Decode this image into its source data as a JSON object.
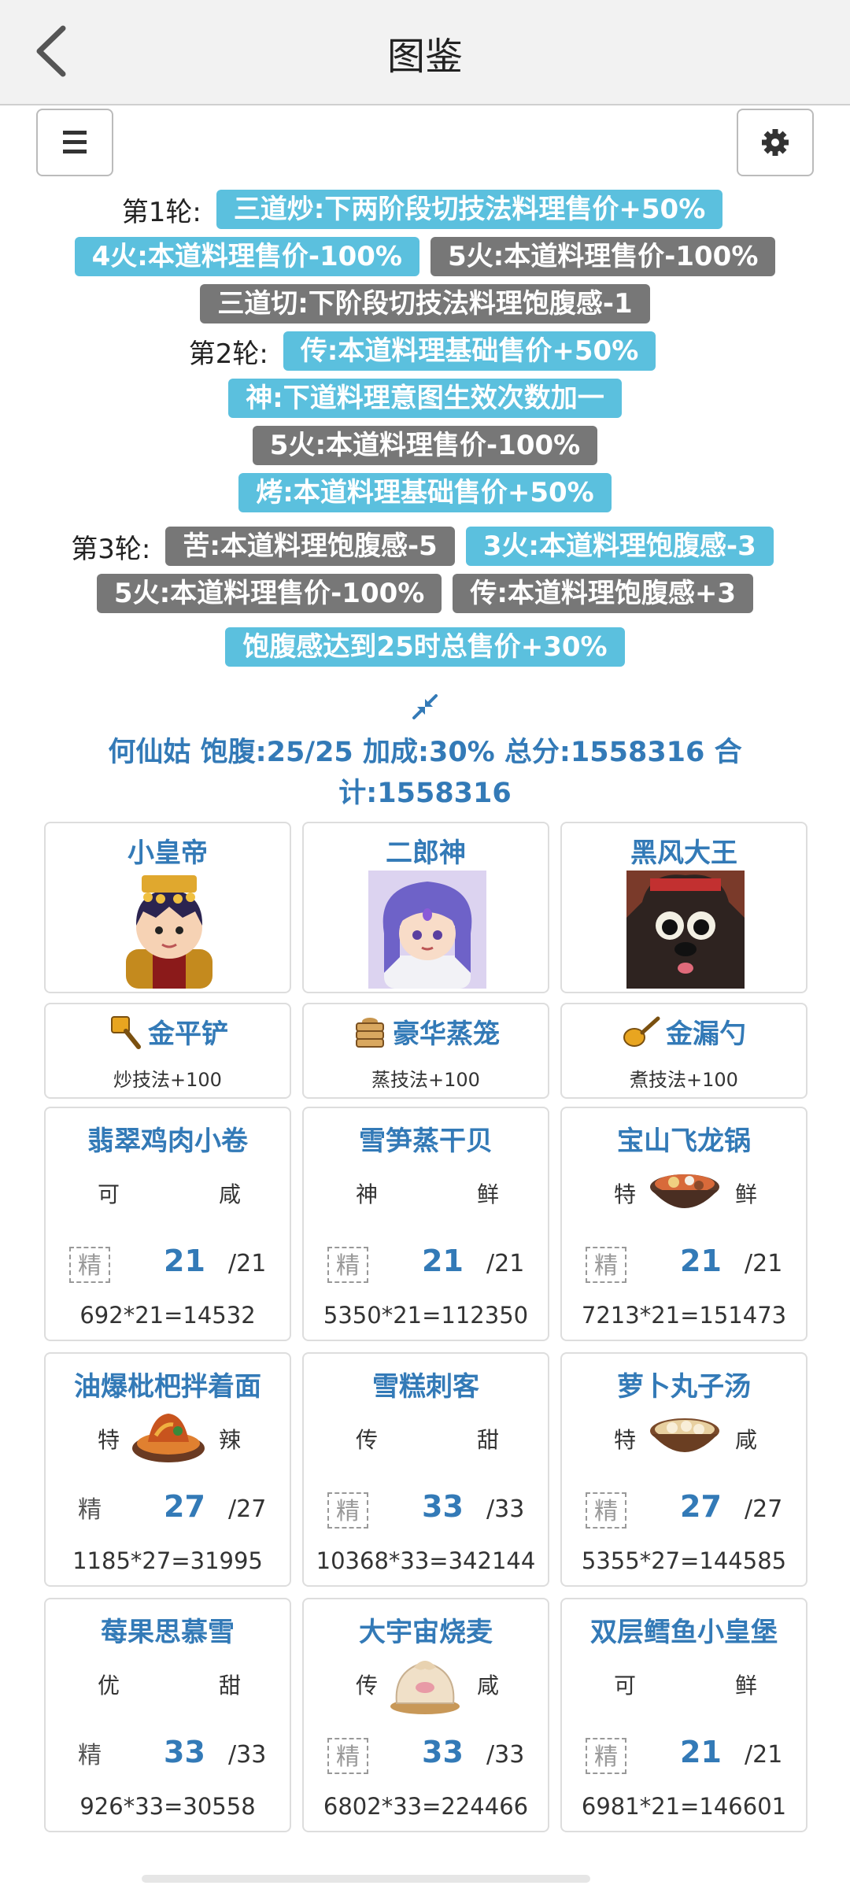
{
  "header": {
    "title": "图鉴"
  },
  "rounds": [
    {
      "label": "第1轮:",
      "rows": [
        [
          {
            "text": "三道炒:下两阶段切技法料理售价+50%",
            "color": "blue"
          }
        ],
        [
          {
            "text": "4火:本道料理售价-100%",
            "color": "blue"
          },
          {
            "text": "5火:本道料理售价-100%",
            "color": "gray"
          }
        ],
        [
          {
            "text": "三道切:下阶段切技法料理饱腹感-1",
            "color": "gray"
          }
        ]
      ]
    },
    {
      "label": "第2轮:",
      "rows": [
        [
          {
            "text": "传:本道料理基础售价+50%",
            "color": "blue"
          }
        ],
        [
          {
            "text": "神:下道料理意图生效次数加一",
            "color": "blue"
          }
        ],
        [
          {
            "text": "5火:本道料理售价-100%",
            "color": "gray"
          }
        ],
        [
          {
            "text": "烤:本道料理基础售价+50%",
            "color": "blue"
          }
        ]
      ]
    },
    {
      "label": "第3轮:",
      "rows": [
        [
          {
            "text": "苦:本道料理饱腹感-5",
            "color": "gray"
          },
          {
            "text": "3火:本道料理饱腹感-3",
            "color": "blue"
          }
        ],
        [
          {
            "text": "5火:本道料理售价-100%",
            "color": "gray"
          },
          {
            "text": "传:本道料理饱腹感+3",
            "color": "gray"
          }
        ],
        [
          {
            "text": "饱腹感达到25时总售价+30%",
            "color": "blue"
          }
        ]
      ]
    }
  ],
  "summary": "何仙姑 饱腹:25/25 加成:30% 总分:1558316 合计:1558316",
  "chefs": [
    {
      "name": "小皇帝",
      "avatar": "emperor-avatar"
    },
    {
      "name": "二郎神",
      "avatar": "erlang-avatar"
    },
    {
      "name": "黑风大王",
      "avatar": "black-wind-avatar"
    }
  ],
  "equips": [
    {
      "name": "金平铲",
      "skill": "炒技法+100",
      "icon": "spatula-icon"
    },
    {
      "name": "豪华蒸笼",
      "skill": "蒸技法+100",
      "icon": "steamer-icon"
    },
    {
      "name": "金漏勺",
      "skill": "煮技法+100",
      "icon": "ladle-icon"
    }
  ],
  "dishes": [
    {
      "name": "翡翠鸡肉小卷",
      "tag1": "可",
      "tag2": "咸",
      "jing": "精",
      "jing_style": "boxed",
      "qty": "21",
      "max": "/21",
      "calc": "692*21=14532",
      "icon": ""
    },
    {
      "name": "雪笋蒸干贝",
      "tag1": "神",
      "tag2": "鲜",
      "jing": "精",
      "jing_style": "boxed",
      "qty": "21",
      "max": "/21",
      "calc": "5350*21=112350",
      "icon": ""
    },
    {
      "name": "宝山飞龙锅",
      "tag1": "特",
      "tag2": "鲜",
      "jing": "精",
      "jing_style": "boxed",
      "qty": "21",
      "max": "/21",
      "calc": "7213*21=151473",
      "icon": "hotpot-icon"
    },
    {
      "name": "油爆枇杷拌着面",
      "tag1": "特",
      "tag2": "辣",
      "jing": "精",
      "jing_style": "plain",
      "qty": "27",
      "max": "/27",
      "calc": "1185*27=31995",
      "icon": "fried-dish-icon"
    },
    {
      "name": "雪糕刺客",
      "tag1": "传",
      "tag2": "甜",
      "jing": "精",
      "jing_style": "boxed",
      "qty": "33",
      "max": "/33",
      "calc": "10368*33=342144",
      "icon": ""
    },
    {
      "name": "萝卜丸子汤",
      "tag1": "特",
      "tag2": "咸",
      "jing": "精",
      "jing_style": "boxed",
      "qty": "27",
      "max": "/27",
      "calc": "5355*27=144585",
      "icon": "soup-icon"
    },
    {
      "name": "莓果思慕雪",
      "tag1": "优",
      "tag2": "甜",
      "jing": "精",
      "jing_style": "plain",
      "qty": "33",
      "max": "/33",
      "calc": "926*33=30558",
      "icon": ""
    },
    {
      "name": "大宇宙烧麦",
      "tag1": "传",
      "tag2": "咸",
      "jing": "精",
      "jing_style": "boxed",
      "qty": "33",
      "max": "/33",
      "calc": "6802*33=224466",
      "icon": "shaomai-icon"
    },
    {
      "name": "双层鳕鱼小皇堡",
      "tag1": "可",
      "tag2": "鲜",
      "jing": "精",
      "jing_style": "boxed",
      "qty": "21",
      "max": "/21",
      "calc": "6981*21=146601",
      "icon": ""
    }
  ],
  "colors": {
    "blue_tag": "#5bc0de",
    "gray_tag": "#777777",
    "link_blue": "#337ab7"
  }
}
